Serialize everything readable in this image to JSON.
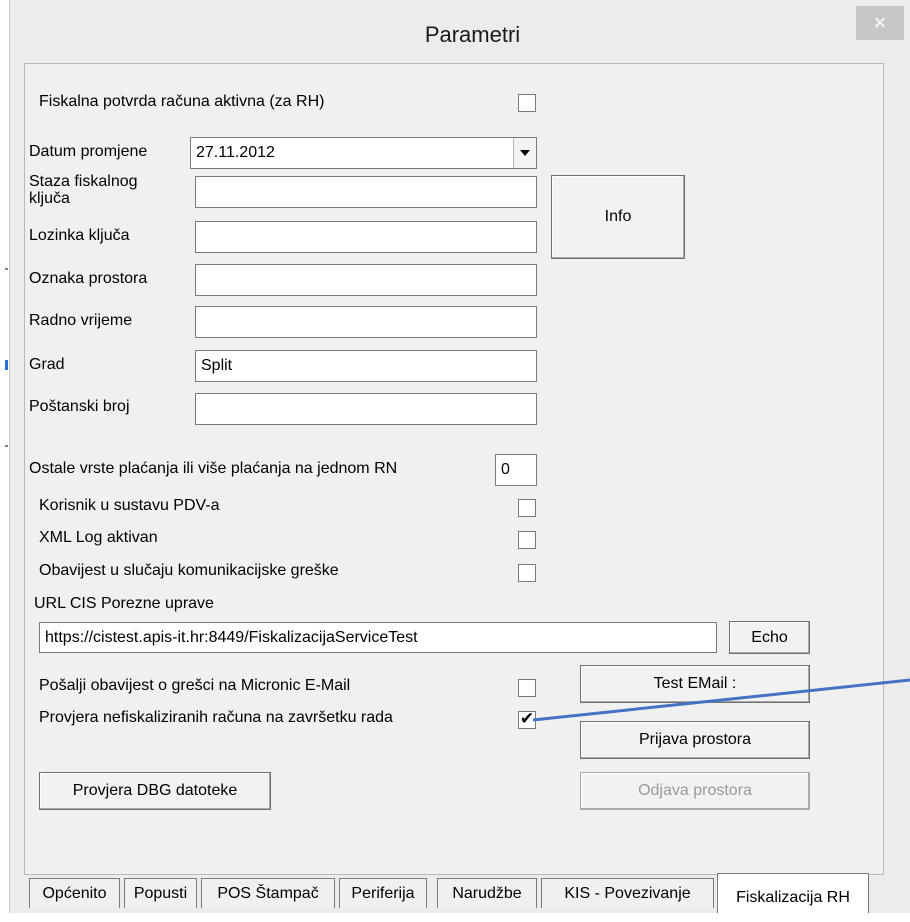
{
  "window": {
    "title": "Parametri",
    "close_glyph": "×"
  },
  "form": {
    "fiscal_active_label": "Fiskalna potvrda računa aktivna (za RH)",
    "date_label": "Datum promjene",
    "date_value": "27.11.2012",
    "key_path_label": "Staza fiskalnog ključa",
    "key_path_value": "",
    "key_password_label": "Lozinka ključa",
    "key_password_value": "",
    "premise_code_label": "Oznaka prostora",
    "premise_code_value": "",
    "working_hours_label": "Radno vrijeme",
    "working_hours_value": "",
    "city_label": "Grad",
    "city_value": "Split",
    "postal_label": "Poštanski broj",
    "postal_value": "",
    "info_button": "Info",
    "other_payments_label": "Ostale vrste plaćanja ili više plaćanja na jednom RN",
    "other_payments_value": "0",
    "vat_user_label": "Korisnik u sustavu PDV-a",
    "xml_log_label": "XML Log aktivan",
    "notify_error_label": "Obavijest u slučaju komunikacijske greške",
    "url_label": "URL CIS Porezne uprave",
    "url_value": "https://cistest.apis-it.hr:8449/FiskalizacijaServiceTest",
    "echo_button": "Echo",
    "send_email_label": "Pošalji obavijest o grešci na Micronic E-Mail",
    "test_email_button": "Test EMail :",
    "check_unfiscal_label": "Provjera nefiskaliziranih računa na završetku rada",
    "check_unfiscal_checked": "✔",
    "register_premise_button": "Prijava prostora",
    "dbg_check_button": "Provjera DBG datoteke",
    "unregister_premise_button": "Odjava prostora"
  },
  "tabs": [
    "Općenito",
    "Popusti",
    "POS Štampač",
    "Periferija",
    "Narudžbe",
    "KIS - Povezivanje",
    "Fiskalizacija RH"
  ],
  "colors": {
    "annotation_line": "#4472c4",
    "accent_edge": "#2b6fd6"
  }
}
